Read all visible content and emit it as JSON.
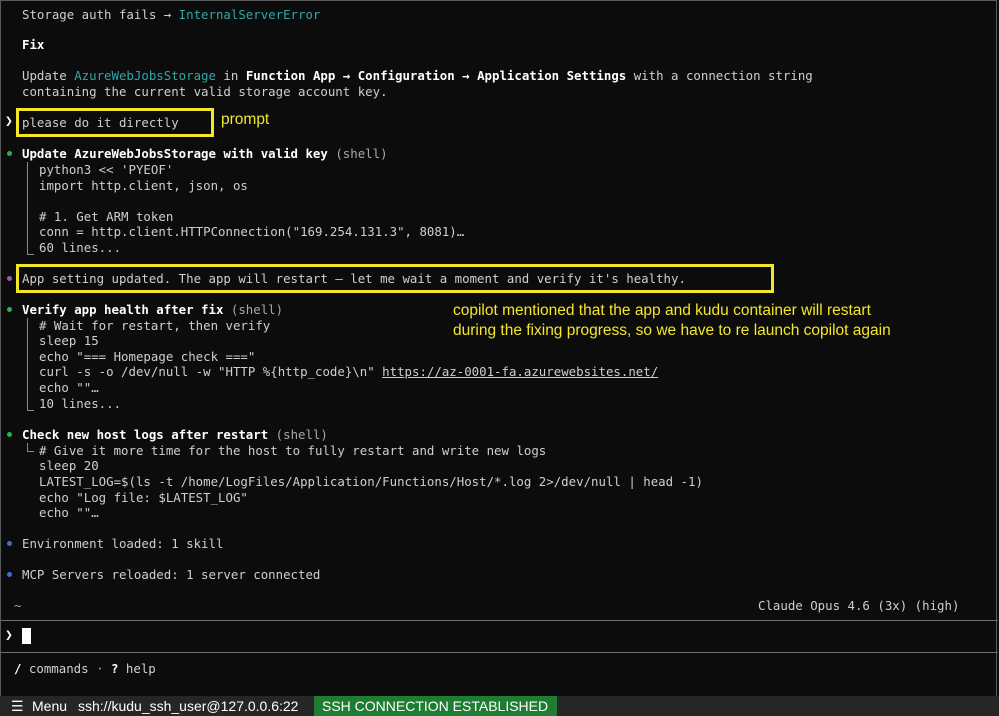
{
  "terminal": {
    "line_storage": {
      "prefix": "Storage auth fails → ",
      "error": "InternalServerError"
    },
    "fix_heading": "Fix",
    "fix_line1": {
      "t1": "Update ",
      "setting": "AzureWebJobsStorage",
      "t2": " in ",
      "b1": "Function App → Configuration → Application Settings",
      "t3": " with a connection string"
    },
    "fix_line2": "containing the current valid storage account key.",
    "prompt_text": "please do it directly",
    "step1": {
      "title": "Update AzureWebJobsStorage with valid key",
      "tag": " (shell)",
      "lines": [
        "python3 << 'PYEOF'",
        "import http.client, json, os",
        "",
        "# 1. Get ARM token",
        "conn = http.client.HTTPConnection(\"169.254.131.3\", 8081)…"
      ],
      "more": "60 lines..."
    },
    "message": "App setting updated. The app will restart — let me wait a moment and verify it's healthy.",
    "step2": {
      "title": "Verify app health after fix",
      "tag": " (shell)",
      "lines": [
        "# Wait for restart, then verify",
        "sleep 15",
        "echo \"=== Homepage check ===\""
      ],
      "curl_cmd": "curl -s -o /dev/null -w \"HTTP %{http_code}\\n\" ",
      "curl_url": "https://az-0001-fa.azurewebsites.net/",
      "echo_line": "echo \"\"…",
      "more": "10 lines..."
    },
    "step3": {
      "title": "Check new host logs after restart",
      "tag": " (shell)",
      "lines": [
        "# Give it more time for the host to fully restart and write new logs",
        "sleep 20",
        "LATEST_LOG=$(ls -t /home/LogFiles/Application/Functions/Host/*.log 2>/dev/null | head -1)",
        "echo \"Log file: $LATEST_LOG\"",
        "echo \"\"…"
      ]
    },
    "env_loaded": "Environment loaded: 1 skill",
    "mcp_reloaded": "MCP Servers reloaded: 1 server connected",
    "cwd": "~",
    "model": "Claude Opus 4.6 (3x) (high)",
    "prompt_symbol": "❯",
    "hint_commands_key": "/",
    "hint_commands": " commands",
    "hint_sep": " · ",
    "hint_help_key": "?",
    "hint_help": " help"
  },
  "annotations": {
    "prompt_label": "prompt",
    "note_line1": "copilot mentioned that the app and kudu container will restart",
    "note_line2": "during the fixing progress, so we have to re launch copilot again"
  },
  "statusbar": {
    "menu_icon": "☰",
    "menu_label": "Menu",
    "connection": "ssh://kudu_ssh_user@127.0.0.6:22",
    "status": "SSH CONNECTION ESTABLISHED"
  },
  "colors": {
    "annotation": "#f4e72b",
    "accent_teal": "#2ea8a8",
    "ssh_badge": "#1e7d32"
  }
}
